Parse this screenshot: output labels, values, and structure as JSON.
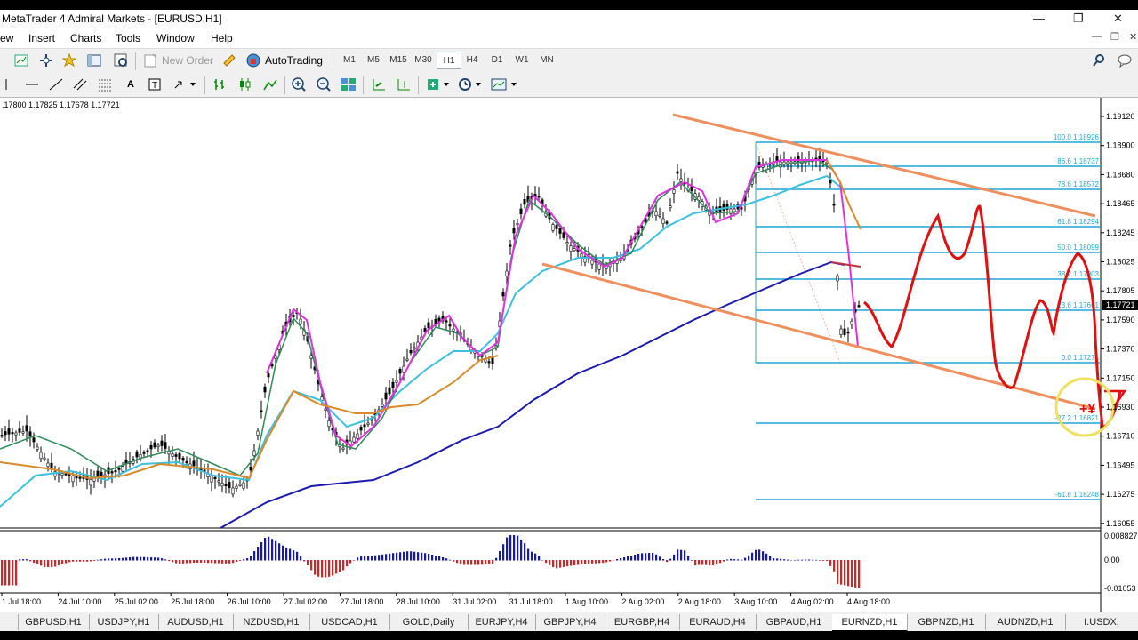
{
  "window": {
    "title": "MetaTrader 4 Admiral Markets - [EURUSD,H1]",
    "controls": [
      "—",
      "❐",
      "✕"
    ],
    "mdi_controls": [
      "—",
      "❐",
      "✕"
    ]
  },
  "menu": [
    "ew",
    "Insert",
    "Charts",
    "Tools",
    "Window",
    "Help"
  ],
  "toolbar": {
    "new_order": "New Order",
    "autotrading": "AutoTrading",
    "timeframes": [
      "M1",
      "M5",
      "M15",
      "M30",
      "H1",
      "H4",
      "D1",
      "W1",
      "MN"
    ],
    "active_timeframe": "H1"
  },
  "chart": {
    "ohlc": ".17800 1.17825 1.17678 1.17721",
    "price_scale": [
      "1.19120",
      "1.18900",
      "1.18680",
      "1.18465",
      "1.18245",
      "1.18025",
      "1.17805",
      "1.17590",
      "1.17370",
      "1.17150",
      "1.16930",
      "1.16710",
      "1.16495",
      "1.16275",
      "1.16055"
    ],
    "current_price": "1.17721",
    "indicator_scale": [
      "0.008827",
      "0.00",
      "-0.01053"
    ],
    "time_scale": [
      "1 Jul 18:00",
      "24 Jul 10:00",
      "25 Jul 02:00",
      "25 Jul 18:00",
      "26 Jul 10:00",
      "27 Jul 02:00",
      "27 Jul 18:00",
      "28 Jul 10:00",
      "31 Jul 02:00",
      "31 Jul 18:00",
      "1 Aug 10:00",
      "2 Aug 02:00",
      "2 Aug 18:00",
      "3 Aug 10:00",
      "4 Aug 02:00",
      "4 Aug 18:00"
    ],
    "fib_labels": [
      "100.0 1.18926",
      "86.6 1.18737",
      "78.6 1.18572",
      "61.8 1.18294",
      "50.0 1.18099",
      "38.2 1.17903",
      "23.6 1.17661",
      "0.0 1.17271",
      "-27.2 1.16821",
      "-61.8 1.16248"
    ],
    "annotation": "+¥",
    "colors": {
      "fib": "#1ea7d6",
      "channel": "#ef8f5e",
      "ma_slow": "#1b1bb0",
      "ma_mid": "#3cc0e0",
      "ma_fast": "#2e8b57",
      "ma_magenta": "#e030e0",
      "ma_orange": "#d98a2a",
      "drawing": "#e01010",
      "circle": "#f0e060"
    }
  },
  "tabs": [
    "GBPUSD,H1",
    "USDJPY,H1",
    "AUDUSD,H1",
    "NZDUSD,H1",
    "USDCAD,H1",
    "GOLD,Daily",
    "EURJPY,H4",
    "GBPJPY,H4",
    "EURGBP,H4",
    "EURAUD,H4",
    "GBPAUD,H1",
    "EURNZD,H1",
    "GBPNZD,H1",
    "AUDNZD,H1",
    "I.USDX,"
  ],
  "active_tab": "EURNZD,H1"
}
